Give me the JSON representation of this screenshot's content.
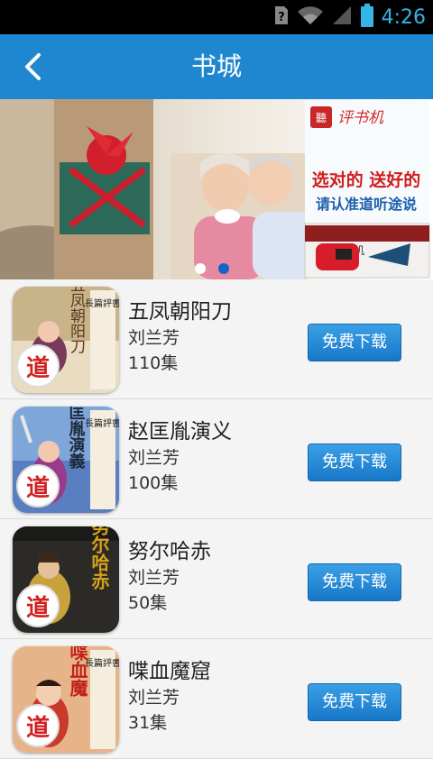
{
  "status_bar": {
    "time": "4:26",
    "time_color": "#33b5e5",
    "icons": [
      "sim-question-icon",
      "wifi-icon",
      "signal-icon",
      "battery-icon"
    ]
  },
  "header": {
    "title": "书城",
    "background": "#1f87cf",
    "back_icon": "back-chevron-icon"
  },
  "banner": {
    "brand_label": "评书机",
    "headline": "选对的 送好的",
    "subline": "请认准道听途说",
    "device_label": "評书机",
    "page_indicator": {
      "count": 2,
      "active_index": 1
    }
  },
  "books": [
    {
      "title": "五凤朝阳刀",
      "author": "刘兰芳",
      "episodes": "110集",
      "button_label": "免费下载",
      "cover_text": "五凤朝阳刀",
      "cover_series": "長篇評書",
      "badge": "道"
    },
    {
      "title": "赵匡胤演义",
      "author": "刘兰芳",
      "episodes": "100集",
      "button_label": "免费下载",
      "cover_text": "赵匡胤演義",
      "cover_series": "長篇評書",
      "badge": "道"
    },
    {
      "title": "努尔哈赤",
      "author": "刘兰芳",
      "episodes": "50集",
      "button_label": "免费下载",
      "cover_text": "努尔哈赤",
      "cover_series": "",
      "badge": "道"
    },
    {
      "title": "喋血魔窟",
      "author": "刘兰芳",
      "episodes": "31集",
      "button_label": "免费下载",
      "cover_text": "喋血魔",
      "cover_series": "長篇評書",
      "badge": "道"
    }
  ]
}
